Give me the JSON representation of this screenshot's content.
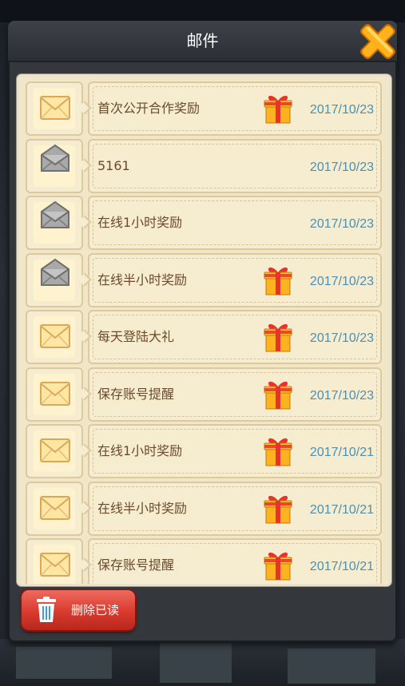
{
  "dialog": {
    "title": "邮件",
    "close_icon": "close-x-icon",
    "delete_read_label": "删除已读"
  },
  "colors": {
    "subject_text": "#6b4a2d",
    "date_text": "#4f8fae",
    "row_background": "#f6ecd0",
    "delete_button": "#d93a2e"
  },
  "mails": [
    {
      "subject": "首次公开合作奖励",
      "date": "2017/10/23",
      "read": false,
      "has_gift": true
    },
    {
      "subject": "5161",
      "date": "2017/10/23",
      "read": true,
      "has_gift": false
    },
    {
      "subject": "在线1小时奖励",
      "date": "2017/10/23",
      "read": true,
      "has_gift": false
    },
    {
      "subject": "在线半小时奖励",
      "date": "2017/10/23",
      "read": true,
      "has_gift": true
    },
    {
      "subject": "每天登陆大礼",
      "date": "2017/10/23",
      "read": false,
      "has_gift": true
    },
    {
      "subject": "保存账号提醒",
      "date": "2017/10/23",
      "read": false,
      "has_gift": true
    },
    {
      "subject": "在线1小时奖励",
      "date": "2017/10/21",
      "read": false,
      "has_gift": true
    },
    {
      "subject": "在线半小时奖励",
      "date": "2017/10/21",
      "read": false,
      "has_gift": true
    },
    {
      "subject": "保存账号提醒",
      "date": "2017/10/21",
      "read": false,
      "has_gift": true
    }
  ]
}
